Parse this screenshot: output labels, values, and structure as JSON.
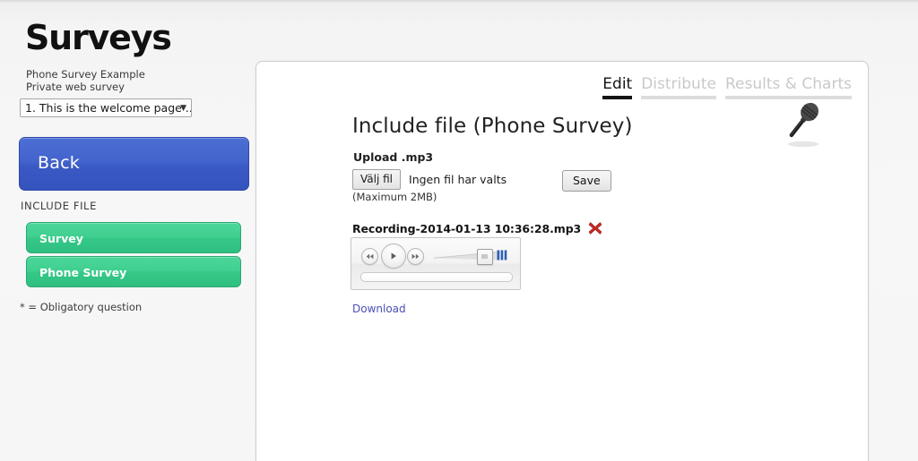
{
  "brand": {
    "title": "Surveys"
  },
  "sidebar": {
    "survey_name": "Phone Survey Example",
    "survey_type": "Private web survey",
    "page_select": {
      "selected": "1. This is the welcome page ...",
      "caret": "▼",
      "options": [
        "1. This is the welcome page ..."
      ]
    },
    "back_label": "Back",
    "section_label": "INCLUDE FILE",
    "nav_buttons": [
      {
        "label": "Survey"
      },
      {
        "label": "Phone Survey"
      }
    ],
    "obligatory_note": "* = Obligatory question",
    "colors": {
      "back_button": "#3d5ec6",
      "nav_button": "#3ecf90"
    }
  },
  "tabs": [
    {
      "label": "Edit",
      "active": true
    },
    {
      "label": "Distribute",
      "active": false
    },
    {
      "label": "Results & Charts",
      "active": false
    }
  ],
  "main": {
    "heading": "Include file (Phone Survey)",
    "upload_label": "Upload .mp3",
    "file_input": {
      "button_label": "Välj fil",
      "status_text": "Ingen fil har valts"
    },
    "max_size_note": "(Maximum 2MB)",
    "save_label": "Save",
    "recording": {
      "filename": "Recording-2014-01-13 10:36:28.mp3",
      "delete_icon": "red-x-icon"
    },
    "player": {
      "prev_icon": "rewind-icon",
      "play_icon": "play-icon",
      "next_icon": "fast-forward-icon",
      "volume_icon": "volume-bars-icon"
    },
    "download_label": "Download",
    "mic_icon": "microphone-icon"
  }
}
